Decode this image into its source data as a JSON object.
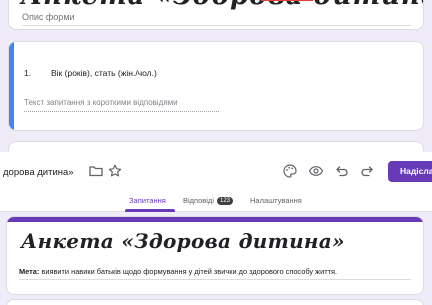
{
  "top_form": {
    "title_cut": "Анкета «Здорова дитина»",
    "description_placeholder": "Опис форми"
  },
  "question": {
    "number": "1.",
    "text": "Вік  (років), стать (жін./чол.)",
    "answer_placeholder": "Текст запитання з короткими відповідями"
  },
  "header": {
    "doc_title": "дорова дитина»",
    "icons": [
      "folder-icon",
      "star-icon",
      "palette-icon",
      "preview-eye-icon",
      "undo-icon",
      "redo-icon"
    ],
    "send_label": "Надіслати"
  },
  "tabs": {
    "questions": "Запитання",
    "responses": "Відповіді",
    "responses_count": "123",
    "settings": "Налаштування"
  },
  "form": {
    "title": "Анкета «Здорова дитина»",
    "description_label": "Мета:",
    "description_text": " виявити навики батьків щодо формування у дітей звички до здорового способу життя."
  },
  "colors": {
    "accent": "#673ab7",
    "background": "#f0ebf8",
    "question_accent": "#4285f4"
  }
}
